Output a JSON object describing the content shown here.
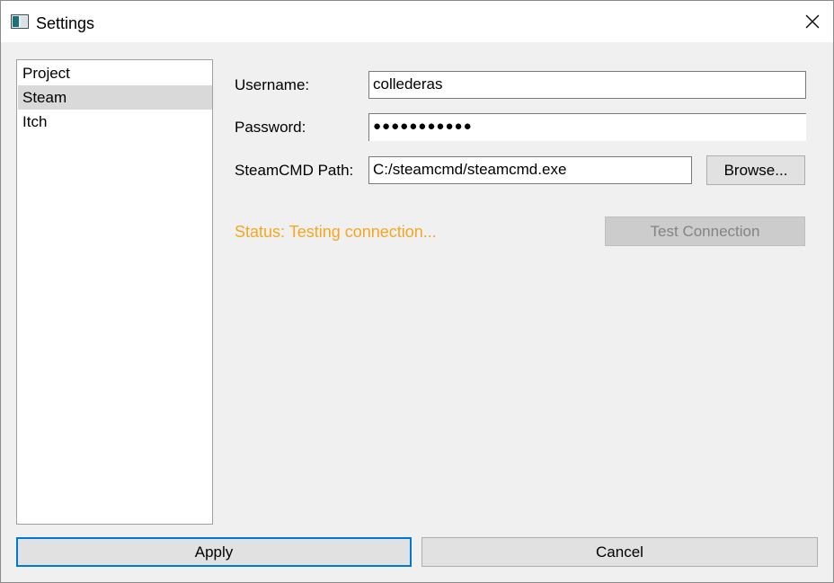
{
  "window": {
    "title": "Settings",
    "app_icon": "window-app-icon",
    "close_icon": "close-icon"
  },
  "sidebar": {
    "items": [
      {
        "label": "Project",
        "selected": false
      },
      {
        "label": "Steam",
        "selected": true
      },
      {
        "label": "Itch",
        "selected": false
      }
    ]
  },
  "form": {
    "username_label": "Username:",
    "username_value": "collederas",
    "password_label": "Password:",
    "password_value": "●●●●●●●●●●●",
    "steamcmd_label": "SteamCMD Path:",
    "steamcmd_value": "C:/steamcmd/steamcmd.exe",
    "browse_label": "Browse...",
    "status_text": "Status: Testing connection...",
    "status_color": "#f5a623",
    "test_connection_label": "Test Connection",
    "test_connection_enabled": false
  },
  "footer": {
    "apply_label": "Apply",
    "cancel_label": "Cancel"
  },
  "colors": {
    "selection_bg": "#d9d9d9",
    "focus_border": "#0078d7"
  }
}
